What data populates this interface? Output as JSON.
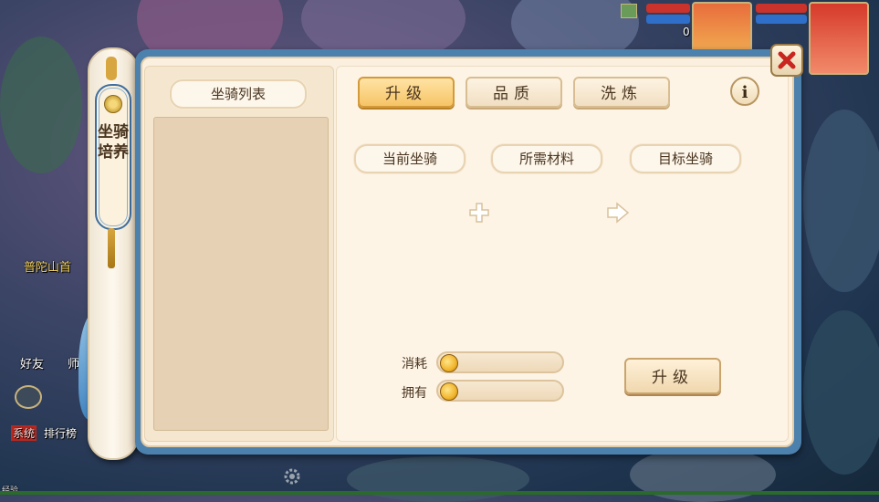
{
  "window": {
    "scroll_title": "坐骑培养",
    "list_header": "坐骑列表",
    "tabs": [
      {
        "label": "升级",
        "active": true
      },
      {
        "label": "品质",
        "active": false
      },
      {
        "label": "洗炼",
        "active": false
      }
    ],
    "info_label": "i",
    "slots": {
      "current": "当前坐骑",
      "materials": "所需材料",
      "target": "目标坐骑"
    },
    "resources": {
      "consume_label": "消耗",
      "consume_value": "",
      "own_label": "拥有",
      "own_value": ""
    },
    "upgrade_button": "升级"
  },
  "background": {
    "side_labels": [
      "普陀山首",
      "好友",
      "师",
      "排行榜"
    ],
    "hud_number": "0",
    "chat_tag": "系统",
    "bottom_text": "经验"
  },
  "colors": {
    "panel_frame": "#4c80ad",
    "panel_fill": "#fbefdf",
    "tab_active": "#f6c466",
    "close_x": "#c8261e"
  },
  "icons": [
    "close-icon",
    "info-icon",
    "plus-icon",
    "arrow-right-icon",
    "coin-icon",
    "gear-icon",
    "chat-icon"
  ]
}
